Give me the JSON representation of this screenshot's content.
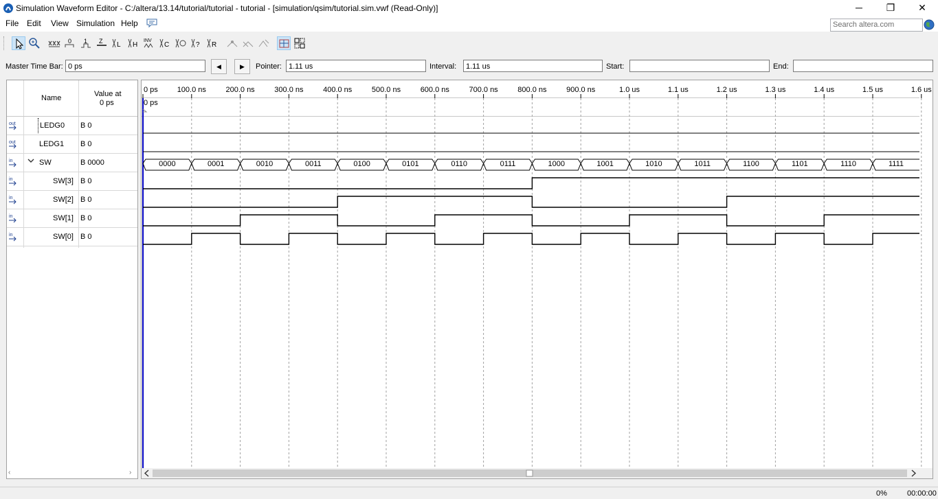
{
  "window": {
    "title": "Simulation Waveform Editor - C:/altera/13.14/tutorial/tutorial - tutorial - [simulation/qsim/tutorial.sim.vwf (Read-Only)]",
    "minimize": "─",
    "maximize": "❐",
    "close": "✕"
  },
  "menu": [
    "File",
    "Edit",
    "View",
    "Simulation",
    "Help"
  ],
  "search": {
    "placeholder": "Search altera.com"
  },
  "timebar": {
    "master_label": "Master Time Bar:",
    "master_value": "0 ps",
    "prev": "◀",
    "next": "▶",
    "pointer_label": "Pointer:",
    "pointer_value": "1.11 us",
    "interval_label": "Interval:",
    "interval_value": "1.11 us",
    "start_label": "Start:",
    "start_value": "",
    "end_label": "End:",
    "end_value": ""
  },
  "signal_table": {
    "name_header": "Name",
    "value_header_1": "Value at",
    "value_header_2": "0 ps",
    "rows": [
      {
        "name": "LEDG0",
        "value": "B 0",
        "dir": "out",
        "group": false,
        "child": false
      },
      {
        "name": "LEDG1",
        "value": "B 0",
        "dir": "out",
        "group": false,
        "child": false
      },
      {
        "name": "SW",
        "value": "B 0000",
        "dir": "in",
        "group": true,
        "child": false
      },
      {
        "name": "SW[3]",
        "value": "B 0",
        "dir": "in",
        "group": false,
        "child": true
      },
      {
        "name": "SW[2]",
        "value": "B 0",
        "dir": "in",
        "group": false,
        "child": true
      },
      {
        "name": "SW[1]",
        "value": "B 0",
        "dir": "in",
        "group": false,
        "child": true
      },
      {
        "name": "SW[0]",
        "value": "B 0",
        "dir": "in",
        "group": false,
        "child": true
      }
    ]
  },
  "ruler": {
    "ticks": [
      "0 ps",
      "100.0 ns",
      "200.0 ns",
      "300.0 ns",
      "400.0 ns",
      "500.0 ns",
      "600.0 ns",
      "700.0 ns",
      "800.0 ns",
      "900.0 ns",
      "1.0 us",
      "1.1 us",
      "1.2 us",
      "1.3 us",
      "1.4 us",
      "1.5 us",
      "1.6 us"
    ],
    "cursor_label": "0 ps"
  },
  "waveforms": {
    "LEDG0": [
      0
    ],
    "LEDG1": [
      0
    ],
    "SW": [
      "0000",
      "0001",
      "0010",
      "0011",
      "0100",
      "0101",
      "0110",
      "0111",
      "1000",
      "1001",
      "1010",
      "1011",
      "1100",
      "1101",
      "1110",
      "1111"
    ],
    "SW[3]": [
      0,
      0,
      0,
      0,
      0,
      0,
      0,
      0,
      1,
      1,
      1,
      1,
      1,
      1,
      1,
      1
    ],
    "SW[2]": [
      0,
      0,
      0,
      0,
      1,
      1,
      1,
      1,
      0,
      0,
      0,
      0,
      1,
      1,
      1,
      1
    ],
    "SW[1]": [
      0,
      0,
      1,
      1,
      0,
      0,
      1,
      1,
      0,
      0,
      1,
      1,
      0,
      0,
      1,
      1
    ],
    "SW[0]": [
      0,
      1,
      0,
      1,
      0,
      1,
      0,
      1,
      0,
      1,
      0,
      1,
      0,
      1,
      0,
      1
    ]
  },
  "status": {
    "percent": "0%",
    "elapsed": "00:00:00"
  },
  "colors": {
    "cursor": "#0000c0",
    "grid": "#a0a0a0",
    "wave": "#000000",
    "selection": "#cce4f7"
  }
}
